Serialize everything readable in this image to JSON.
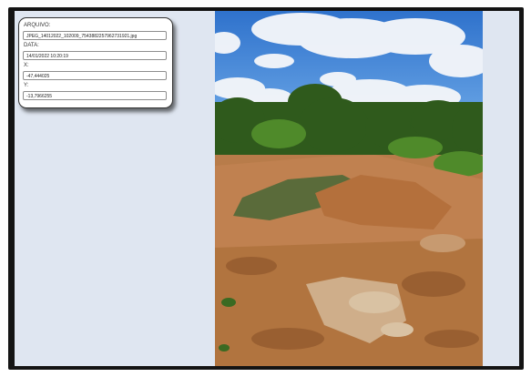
{
  "info": {
    "arquivo_label": "ARQUIVO:",
    "arquivo_value": "JPEG_14012022_102009_7543882257962731921.jpg",
    "data_label": "DATA:",
    "data_value": "14/01/2022 10:20:19",
    "x_label": "X:",
    "x_value": "-47,444025",
    "y_label": "Y:",
    "y_value": "-13,7966255"
  },
  "colors": {
    "frame": "#141414",
    "panel": "#dfe6f1",
    "sky": "#3d7fd4",
    "soil": "#b97a44",
    "vegetation": "#3a6a22"
  },
  "photo": {
    "subject": "dirt-road-with-vegetation-photo"
  }
}
